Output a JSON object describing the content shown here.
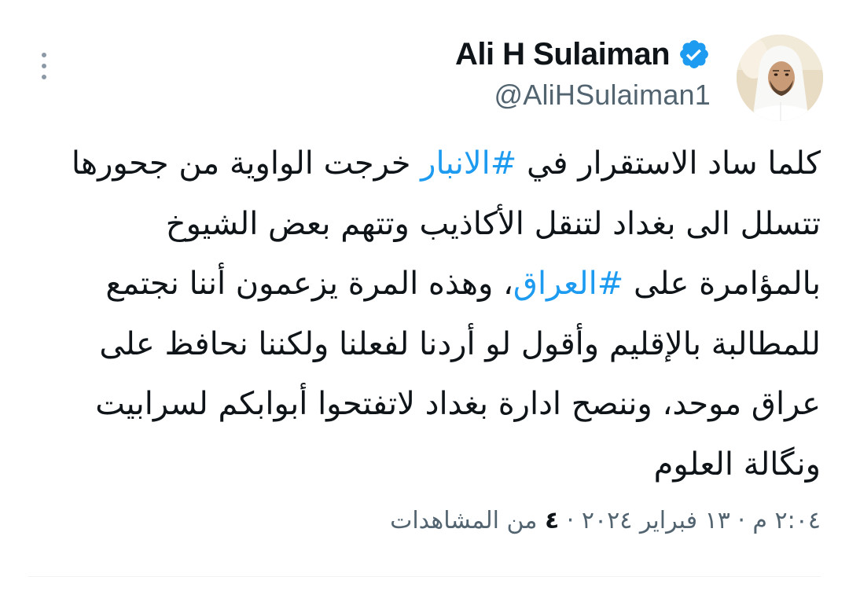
{
  "author": {
    "display_name": "Ali H Sulaiman",
    "handle": "@AliHSulaiman1",
    "verified": true,
    "avatar": "profile-photo"
  },
  "tweet": {
    "lines": [
      [
        {
          "text": "كلما ساد الاستقرار في ",
          "hashtag": false
        },
        {
          "text": "#الانبار",
          "hashtag": true
        },
        {
          "text": " خرجت الواوية من جحورها",
          "hashtag": false
        }
      ],
      [
        {
          "text": "تتسلل الى بغداد لتنقل الأكاذيب وتتهم بعض الشيوخ",
          "hashtag": false
        }
      ],
      [
        {
          "text": "بالمؤامرة على ",
          "hashtag": false
        },
        {
          "text": "#العراق",
          "hashtag": true
        },
        {
          "text": "، وهذه المرة يزعمون أننا نجتمع",
          "hashtag": false
        }
      ],
      [
        {
          "text": "للمطالبة بالإقليم وأقول لو أردنا لفعلنا ولكننا نحافظ على",
          "hashtag": false
        }
      ],
      [
        {
          "text": "عراق موحد، وننصح ادارة بغداد لاتفتحوا أبوابكم لسرابيت",
          "hashtag": false
        }
      ],
      [
        {
          "text": "ونگالة العلوم",
          "hashtag": false
        }
      ]
    ]
  },
  "meta": {
    "timestamp": "٢:٠٤ م · ١٣ فبراير ٢٠٢٤ · ",
    "views_count": "٤",
    "views_label": " من المشاهدات"
  },
  "colors": {
    "hashtag": "#1d9bf0",
    "text": "#0f1419",
    "secondary": "#536471",
    "verified_badge": "#1d9bf0"
  },
  "icons": {
    "more": "more-vertical-icon",
    "verified": "verified-badge-icon"
  }
}
